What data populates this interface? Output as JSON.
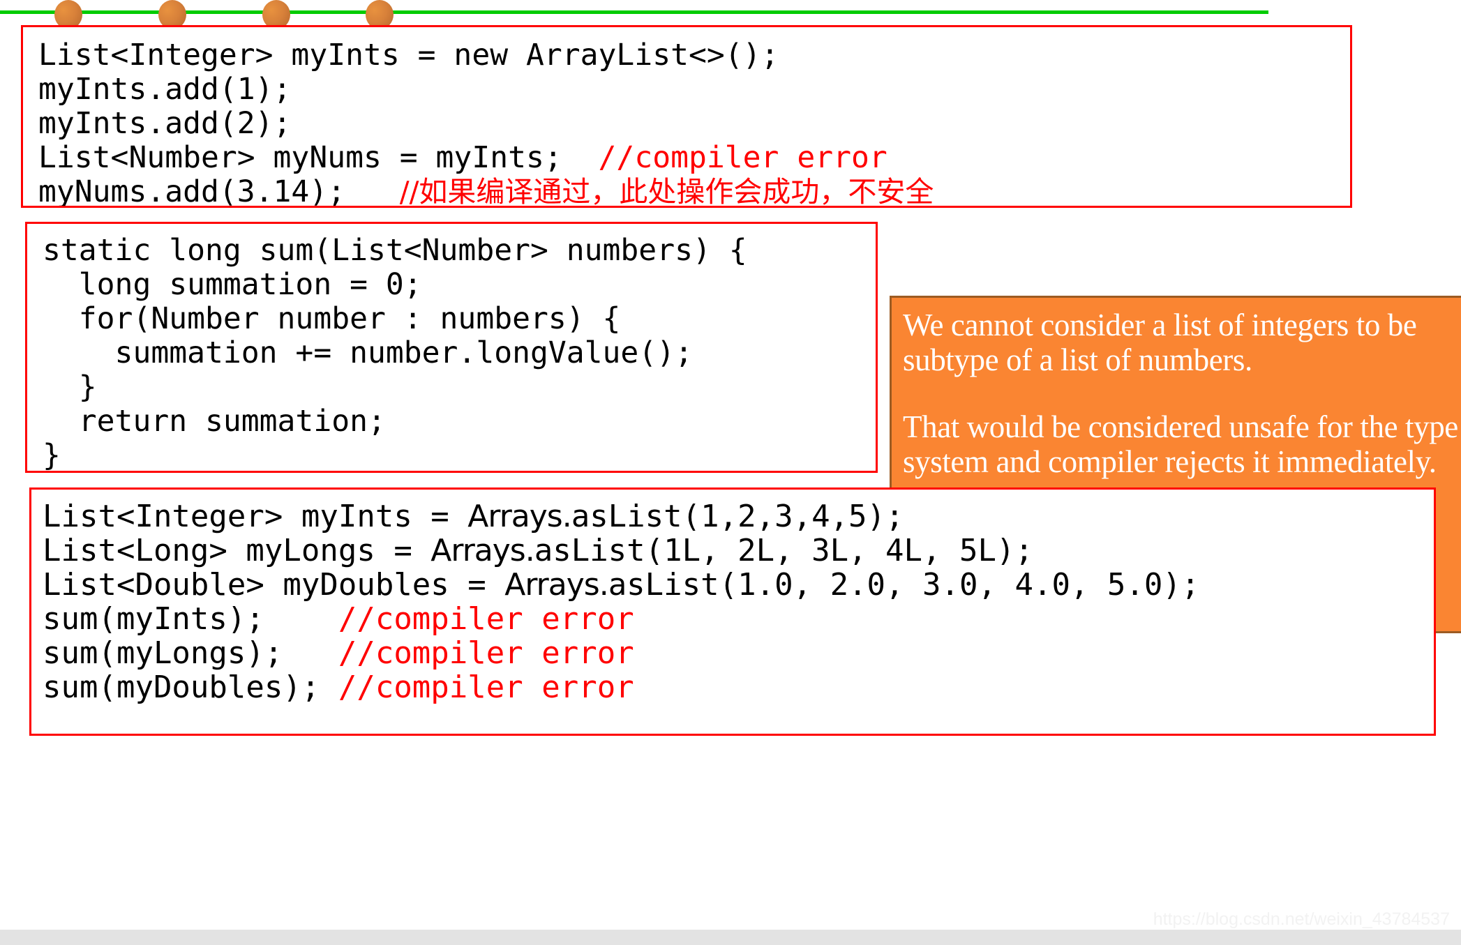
{
  "decoration": {
    "line_color": "#00CC00",
    "dot_color": "#D8813A",
    "dots": 4
  },
  "colors": {
    "code_border": "#FF0000",
    "comment": "#FF0000",
    "callout_bg": "#FA8532",
    "callout_border": "#9C5B22",
    "callout_text": "#FFFFFF",
    "code_text": "#000000",
    "footer_bar": "#E3E3E3"
  },
  "code_box_1": {
    "lines": [
      {
        "code": "List<Integer> myInts = new ArrayList<>();",
        "comment": ""
      },
      {
        "code": "myInts.add(1);",
        "comment": ""
      },
      {
        "code": "myInts.add(2);",
        "comment": ""
      },
      {
        "code": "List<Number> myNums = myInts;  ",
        "comment": "//compiler error"
      },
      {
        "code": "myNums.add(3.14);   ",
        "comment": "//如果编译通过，此处操作会成功，不安全"
      }
    ]
  },
  "code_box_2": {
    "lines": [
      "static long sum(List<Number> numbers) {",
      "  long summation = 0;",
      "  for(Number number : numbers) {",
      "    summation += number.longValue();",
      "  }",
      "  return summation;",
      "}"
    ]
  },
  "code_box_3": {
    "lines": [
      {
        "pre": "List<Integer> myInts = ",
        "prop": "Arrays.",
        "post": "asList(1,2,3,4,5);",
        "comment": ""
      },
      {
        "pre": "List<Long> myLongs = ",
        "prop": "Arrays.",
        "post": "asList(1L, 2L, 3L, 4L, 5L);",
        "comment": ""
      },
      {
        "pre": "List<Double> myDoubles = ",
        "prop": "Arrays.",
        "post": "asList(1.0, 2.0, 3.0, 4.0, 5.0);",
        "comment": ""
      },
      {
        "pre": "sum(myInts);    ",
        "prop": "",
        "post": "",
        "comment": "//compiler error"
      },
      {
        "pre": "sum(myLongs);   ",
        "prop": "",
        "post": "",
        "comment": "//compiler error"
      },
      {
        "pre": "sum(myDoubles); ",
        "prop": "",
        "post": "",
        "comment": "//compiler error"
      }
    ]
  },
  "callout": {
    "paragraph_1": "We cannot consider a list of integers to be subtype of a list of numbers.",
    "paragraph_2": "That would be considered unsafe for the type system and compiler rejects it immediately."
  },
  "footer": {
    "watermark": "https://blog.csdn.net/weixin_43784537"
  }
}
